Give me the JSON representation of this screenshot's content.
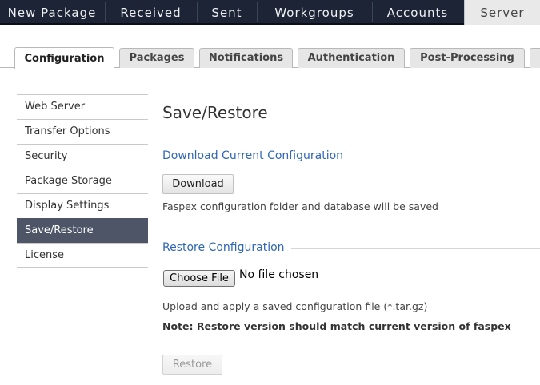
{
  "topnav": {
    "items": [
      "New Package",
      "Received",
      "Sent",
      "Workgroups",
      "Accounts",
      "Server"
    ],
    "active": "Server"
  },
  "tabs": [
    "Configuration",
    "Packages",
    "Notifications",
    "Authentication",
    "Post-Processing"
  ],
  "sidebar": {
    "items": [
      "Web Server",
      "Transfer Options",
      "Security",
      "Package Storage",
      "Display Settings",
      "Save/Restore",
      "License"
    ],
    "active": "Save/Restore"
  },
  "main": {
    "title": "Save/Restore",
    "download_section": {
      "title": "Download Current Configuration",
      "button": "Download",
      "help": "Faspex configuration folder and database will be saved"
    },
    "restore_section": {
      "title": "Restore Configuration",
      "choose_file_button": "Choose File",
      "file_status": "No file chosen",
      "help": "Upload and apply a saved configuration file (*.tar.gz)",
      "note": "Note: Restore version should match current version of faspex",
      "button": "Restore",
      "button_disabled": true
    }
  },
  "colors": {
    "topnav_bg": "#1c2435",
    "sidebar_active_bg": "#4d5566",
    "section_title": "#2f67b3"
  }
}
